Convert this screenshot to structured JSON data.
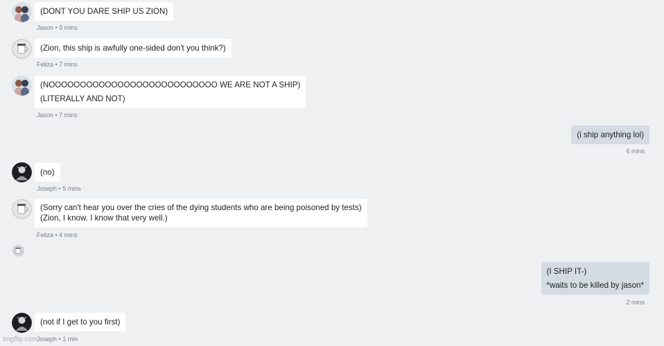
{
  "messages": [
    {
      "sender": "Jason",
      "lines": [
        "(DONT YOU DARE SHIP US ZION)"
      ],
      "time": "9 mins",
      "avatar": "couple-avatar-icon"
    },
    {
      "sender": "Feliza",
      "lines": [
        "(Zion, this ship is awfully one-sided don't you think?)"
      ],
      "time": "7 mins",
      "avatar": "mug-avatar-icon"
    },
    {
      "sender": "Jason",
      "lines": [
        "(NOOOOOOOOOOOOOOOOOOOOOOOOOOO WE ARE NOT A SHIP)",
        "(LITERALLY AND NOT)"
      ],
      "time": "7 mins",
      "avatar": "couple-avatar-icon"
    },
    {
      "sender": "",
      "lines": [
        "(i ship anything lol)"
      ],
      "time": "6 mins",
      "mine": true
    },
    {
      "sender": "Joseph",
      "lines": [
        "(no)"
      ],
      "time": "5 mins",
      "avatar": "dark-figure-avatar-icon"
    },
    {
      "sender": "Feliza",
      "lines": [
        "(Sorry can't hear you over the cries of the dying students who are being poisoned by tests)",
        "(Zion, I know. I know that very well.)"
      ],
      "time": "4 mins",
      "avatar": "mug-avatar-icon"
    },
    {
      "sender": "",
      "lines": [
        "(I SHIP IT-)",
        "*waits to be killed by jason*"
      ],
      "time": "2 mins",
      "mine": true
    },
    {
      "sender": "Joseph",
      "lines": [
        "(not if I get to you first)"
      ],
      "time": "1 min",
      "avatar": "dark-figure-avatar-icon"
    }
  ],
  "meta_separator": " • ",
  "watermark": "imgflip.com",
  "colors": {
    "background": "#eef0f2",
    "bubble_other": "#ffffff",
    "bubble_mine": "#d4dbe2",
    "meta_text": "#7a7f85"
  }
}
